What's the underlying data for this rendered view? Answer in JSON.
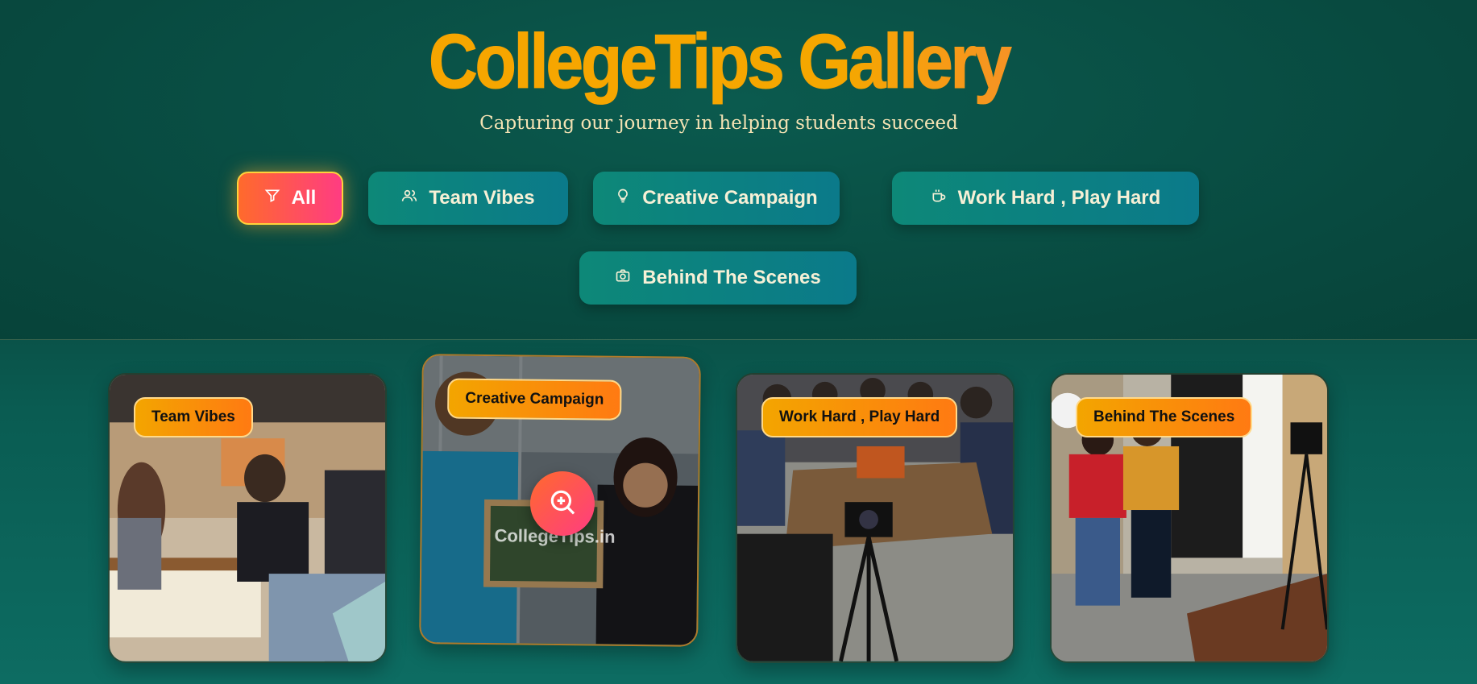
{
  "header": {
    "title": "CollegeTips Gallery",
    "subtitle": "Capturing our journey in helping students succeed"
  },
  "filters": [
    {
      "label": "All",
      "icon": "filter-icon",
      "active": true
    },
    {
      "label": "Team Vibes",
      "icon": "users-icon",
      "active": false
    },
    {
      "label": "Creative Campaign",
      "icon": "lightbulb-icon",
      "active": false
    },
    {
      "label": "Work Hard , Play Hard",
      "icon": "coffee-icon",
      "active": false
    },
    {
      "label": "Behind The Scenes",
      "icon": "camera-icon",
      "active": false
    }
  ],
  "gallery": [
    {
      "tag": "Team Vibes"
    },
    {
      "tag": "Creative Campaign",
      "board_text": "CollegeTips.in"
    },
    {
      "tag": "Work Hard , Play Hard"
    },
    {
      "tag": "Behind The Scenes"
    }
  ],
  "colors": {
    "accent_orange": "#f8a400",
    "active_gradient_start": "#ff6a2c",
    "active_gradient_end": "#ff3c82",
    "chip_teal": "#0d8878",
    "background": "#0a5c52"
  }
}
